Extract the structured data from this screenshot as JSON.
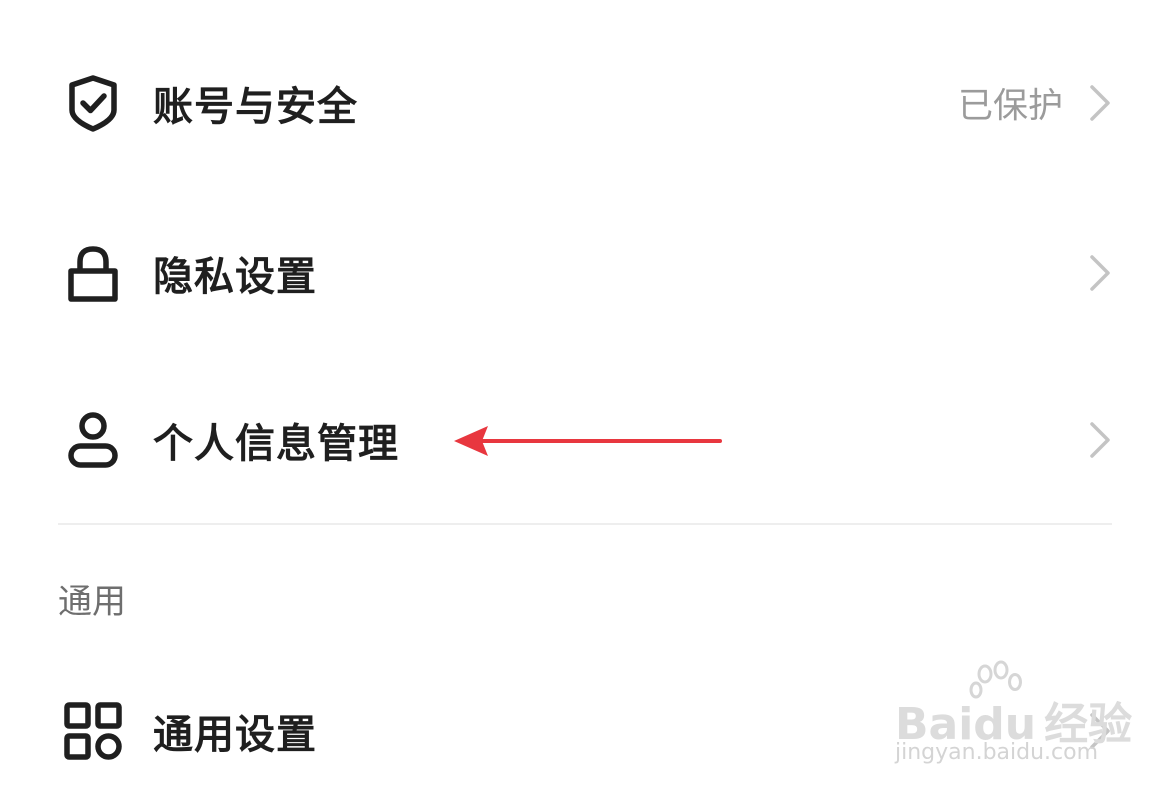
{
  "settings": {
    "items": [
      {
        "label": "账号与安全",
        "value": "已保护",
        "icon": "shield-check-icon"
      },
      {
        "label": "隐私设置",
        "value": "",
        "icon": "lock-icon"
      },
      {
        "label": "个人信息管理",
        "value": "",
        "icon": "user-icon"
      }
    ]
  },
  "general": {
    "section_title": "通用",
    "items": [
      {
        "label": "通用设置",
        "icon": "grid-icon"
      }
    ]
  },
  "annotation": {
    "arrow_color": "#e8373f"
  },
  "watermark": {
    "logo_text": "Baidu",
    "logo_suffix": "经验",
    "url": "jingyan.baidu.com"
  },
  "colors": {
    "label": "#1f1f1f",
    "secondary": "#9b9b9b",
    "chevron": "#c4c4c4",
    "divider": "#eeeeee"
  }
}
